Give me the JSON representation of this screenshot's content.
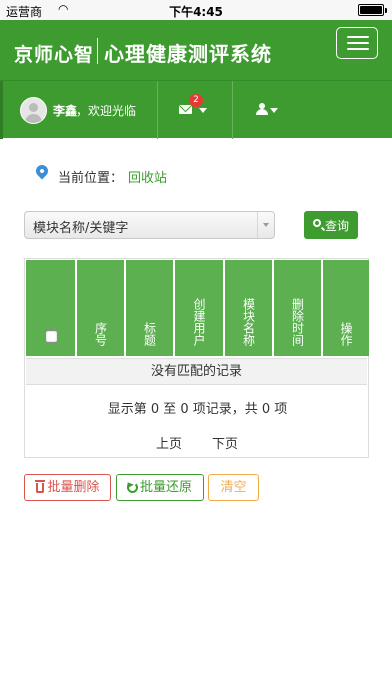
{
  "status_bar": {
    "carrier": "运营商",
    "time": "下午4:45",
    "battery_level": 1.0
  },
  "header": {
    "brand_short": "京师心智",
    "brand_title": "心理健康测评系统"
  },
  "user_bar": {
    "username": "李鑫",
    "welcome": "，欢迎光临",
    "message_count": "2"
  },
  "location": {
    "label": "当前位置：",
    "current": "回收站"
  },
  "search": {
    "select_value": "模块名称/关键字",
    "button_label": "查询"
  },
  "table": {
    "columns": [
      "序号",
      "标题",
      "创建用户",
      "模块名称",
      "删除时间",
      "操作"
    ],
    "empty_message": "没有匹配的记录",
    "info": "显示第 0 至 0 项记录，共 0 项",
    "prev": "上页",
    "next": "下页"
  },
  "actions": {
    "batch_delete": "批量删除",
    "batch_restore": "批量还原",
    "clear": "清空"
  },
  "colors": {
    "brand_green": "#3d9b2f",
    "header_cell_green": "#5cb050",
    "danger": "#d9534f",
    "warning": "#f0ad4e",
    "link_blue": "#3a8fd6"
  }
}
